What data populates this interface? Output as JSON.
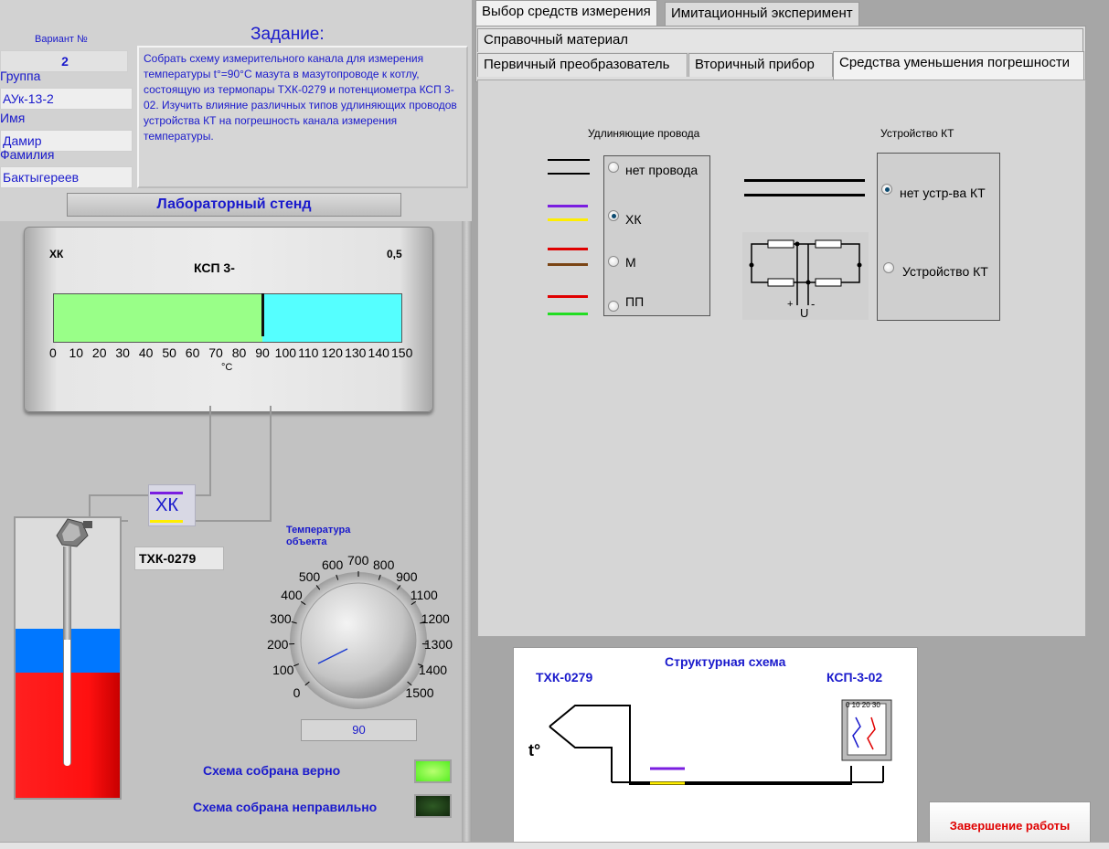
{
  "info": {
    "variant_label": "Вариант №",
    "variant_value": "2",
    "group_label": "Группа",
    "group_value": "АУк-13-2",
    "name_label": "Имя",
    "name_value": "Дамир",
    "surname_label": "Фамилия",
    "surname_value": "Бактыгереев"
  },
  "task": {
    "title": "Задание:",
    "text": "Собрать схему измерительного канала для измерения температуры t°=90°С мазута в мазутопроводе к котлу, состоящую из термопары ТХК-0279 и потенциометра КСП 3-02. Изучить влияние различных типов удлиняющих проводов устройства КТ на погрешность канала измерения температуры."
  },
  "stand_button": "Лабораторный стенд",
  "instrument": {
    "type_label": "ХК",
    "model_label": "КСП 3-",
    "accuracy_label": "0,5",
    "unit": "°C",
    "value": 90,
    "min": 0,
    "max": 150,
    "ticks": [
      "0",
      "10",
      "20",
      "30",
      "40",
      "50",
      "60",
      "70",
      "80",
      "90",
      "100",
      "110",
      "120",
      "130",
      "140",
      "150"
    ]
  },
  "thermocouple_connector": "ХК",
  "thermocouple_model": "ТХК-0279",
  "knob": {
    "title": "Температура объекта",
    "labels": [
      "0",
      "100",
      "200",
      "300",
      "400",
      "500",
      "600",
      "700",
      "800",
      "900",
      "1100",
      "1200",
      "1300",
      "1400",
      "1500"
    ],
    "value_display": "90"
  },
  "status": {
    "correct_label": "Схема собрана верно",
    "wrong_label": "Схема собрана неправильно"
  },
  "tabs_top": [
    "Выбор средств измерения",
    "Имитационный эксперимент"
  ],
  "tabs_sub": [
    "Справочный материал",
    "Первичный преобразователь",
    "Вторичный прибор",
    "Средства уменьшения погрешности"
  ],
  "wires": {
    "title": "Удлиняющие провода",
    "options": [
      "нет провода",
      "ХК",
      "М",
      "ПП"
    ],
    "selected": 1
  },
  "kt": {
    "title": "Устройство КТ",
    "options": [
      "нет устр-ва КТ",
      "Устройство КТ"
    ],
    "selected": 0,
    "bridge_u": "U",
    "bridge_plus": "+",
    "bridge_minus": "-"
  },
  "structure": {
    "title": "Структурная схема",
    "left_label": "ТХК-0279",
    "right_label": "КСП-3-02",
    "t_label": "t°",
    "recorder_ticks": "0 10 20 30"
  },
  "finish_button": "Завершение работы",
  "colors": {
    "accent_blue": "#1a1acc",
    "led_on": "#66ff33",
    "led_off": "#1a3a14"
  }
}
